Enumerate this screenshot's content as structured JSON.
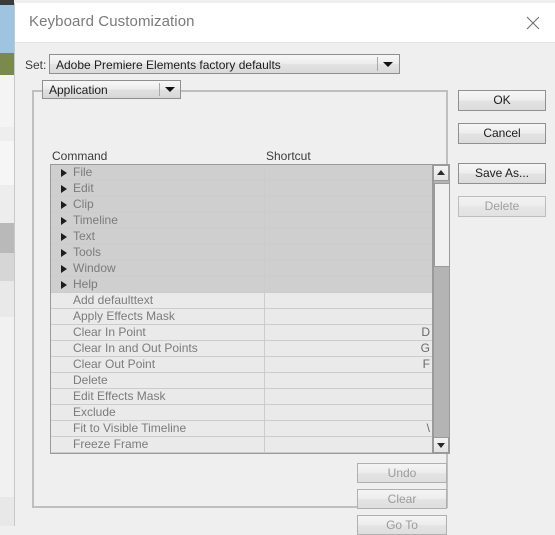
{
  "window": {
    "title": "Keyboard Customization",
    "close_icon": "close-icon"
  },
  "set_row": {
    "label": "Set:",
    "value": "Adobe Premiere Elements factory defaults",
    "dropdown_icon": "chevron-down-icon"
  },
  "category": {
    "value": "Application",
    "dropdown_icon": "chevron-down-icon"
  },
  "columns": {
    "command": "Command",
    "shortcut": "Shortcut"
  },
  "list": {
    "rows": [
      {
        "label": "File",
        "shortcut": "",
        "type": "category"
      },
      {
        "label": "Edit",
        "shortcut": "",
        "type": "category"
      },
      {
        "label": "Clip",
        "shortcut": "",
        "type": "category"
      },
      {
        "label": "Timeline",
        "shortcut": "",
        "type": "category"
      },
      {
        "label": "Text",
        "shortcut": "",
        "type": "category"
      },
      {
        "label": "Tools",
        "shortcut": "",
        "type": "category"
      },
      {
        "label": "Window",
        "shortcut": "",
        "type": "category"
      },
      {
        "label": "Help",
        "shortcut": "",
        "type": "category"
      },
      {
        "label": "Add defaulttext",
        "shortcut": "",
        "type": "command"
      },
      {
        "label": "Apply Effects Mask",
        "shortcut": "",
        "type": "command"
      },
      {
        "label": "Clear In Point",
        "shortcut": "D",
        "type": "command"
      },
      {
        "label": "Clear In and Out Points",
        "shortcut": "G",
        "type": "command"
      },
      {
        "label": "Clear Out Point",
        "shortcut": "F",
        "type": "command"
      },
      {
        "label": "Delete",
        "shortcut": "",
        "type": "command"
      },
      {
        "label": "Edit Effects Mask",
        "shortcut": "",
        "type": "command"
      },
      {
        "label": "Exclude",
        "shortcut": "",
        "type": "command"
      },
      {
        "label": "Fit to Visible Timeline",
        "shortcut": "\\",
        "type": "command"
      },
      {
        "label": "Freeze Frame",
        "shortcut": "",
        "type": "command"
      }
    ]
  },
  "scrollbar": {
    "up_icon": "triangle-up-icon",
    "down_icon": "triangle-down-icon"
  },
  "bottom_buttons": {
    "undo": "Undo",
    "clear": "Clear",
    "goto": "Go To"
  },
  "right_buttons": {
    "ok": "OK",
    "cancel": "Cancel",
    "save_as": "Save As...",
    "delete": "Delete"
  },
  "colors": {
    "dialog_bg": "#efeff0",
    "titlebar_bg": "#ffffff",
    "title_text": "#7a7a7a",
    "list_bg": "#eaeaea",
    "category_row_bg": "#cfcfcf",
    "row_text": "#7b7b7b",
    "border": "#9a9a9a",
    "disabled_text": "#9b9b9b"
  }
}
